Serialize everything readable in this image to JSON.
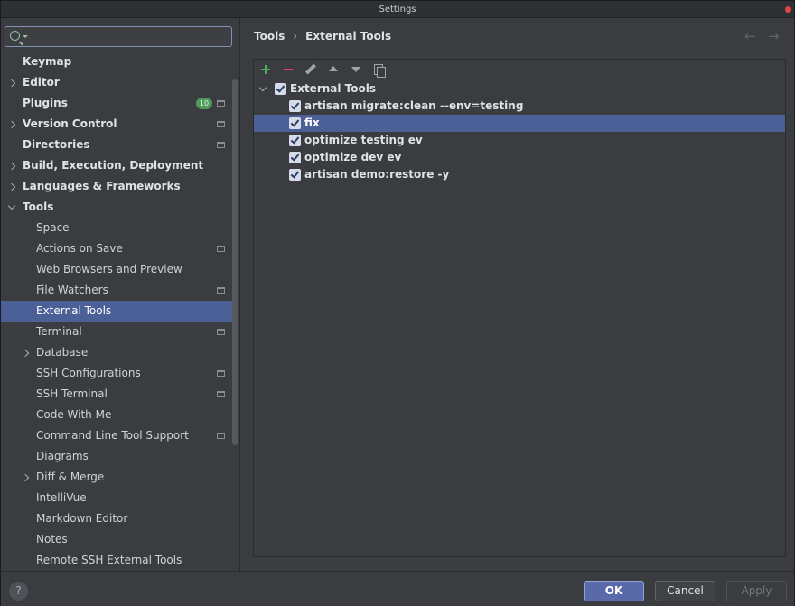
{
  "window": {
    "title": "Settings"
  },
  "search": {
    "placeholder": "",
    "value": ""
  },
  "sidebar": {
    "items": [
      {
        "label": "Keymap",
        "level": 0,
        "chevron": "none",
        "project_icon": false
      },
      {
        "label": "Editor",
        "level": 0,
        "chevron": "right",
        "project_icon": false
      },
      {
        "label": "Plugins",
        "level": 0,
        "chevron": "none",
        "badge": "10",
        "project_icon": true
      },
      {
        "label": "Version Control",
        "level": 0,
        "chevron": "right",
        "project_icon": true
      },
      {
        "label": "Directories",
        "level": 0,
        "chevron": "none",
        "project_icon": true
      },
      {
        "label": "Build, Execution, Deployment",
        "level": 0,
        "chevron": "right",
        "project_icon": false
      },
      {
        "label": "Languages & Frameworks",
        "level": 0,
        "chevron": "right",
        "project_icon": false
      },
      {
        "label": "Tools",
        "level": 0,
        "chevron": "down",
        "project_icon": false
      },
      {
        "label": "Space",
        "level": 1,
        "chevron": "none",
        "project_icon": false
      },
      {
        "label": "Actions on Save",
        "level": 1,
        "chevron": "none",
        "project_icon": true
      },
      {
        "label": "Web Browsers and Preview",
        "level": 1,
        "chevron": "none",
        "project_icon": false
      },
      {
        "label": "File Watchers",
        "level": 1,
        "chevron": "none",
        "project_icon": true
      },
      {
        "label": "External Tools",
        "level": 1,
        "chevron": "none",
        "project_icon": false,
        "selected": true
      },
      {
        "label": "Terminal",
        "level": 1,
        "chevron": "none",
        "project_icon": true
      },
      {
        "label": "Database",
        "level": 1,
        "chevron": "right",
        "project_icon": false
      },
      {
        "label": "SSH Configurations",
        "level": 1,
        "chevron": "none",
        "project_icon": true
      },
      {
        "label": "SSH Terminal",
        "level": 1,
        "chevron": "none",
        "project_icon": true
      },
      {
        "label": "Code With Me",
        "level": 1,
        "chevron": "none",
        "project_icon": false
      },
      {
        "label": "Command Line Tool Support",
        "level": 1,
        "chevron": "none",
        "project_icon": true
      },
      {
        "label": "Diagrams",
        "level": 1,
        "chevron": "none",
        "project_icon": false
      },
      {
        "label": "Diff & Merge",
        "level": 1,
        "chevron": "right",
        "project_icon": false
      },
      {
        "label": "IntelliVue",
        "level": 1,
        "chevron": "none",
        "project_icon": false
      },
      {
        "label": "Markdown Editor",
        "level": 1,
        "chevron": "none",
        "project_icon": false
      },
      {
        "label": "Notes",
        "level": 1,
        "chevron": "none",
        "project_icon": false
      },
      {
        "label": "Remote SSH External Tools",
        "level": 1,
        "chevron": "none",
        "project_icon": false
      }
    ]
  },
  "breadcrumb": {
    "parent": "Tools",
    "separator": "›",
    "current": "External Tools"
  },
  "nav": {
    "back": "←",
    "forward": "→"
  },
  "toolbar": {
    "buttons": [
      "add-icon",
      "remove-icon",
      "edit-icon",
      "move-up-icon",
      "move-down-icon",
      "copy-icon"
    ]
  },
  "external_tools": {
    "group": {
      "label": "External Tools",
      "checked": true
    },
    "tools": [
      {
        "label": "artisan migrate:clean --env=testing",
        "checked": true
      },
      {
        "label": "fix",
        "checked": true,
        "selected": true
      },
      {
        "label": "optimize testing ev",
        "checked": true
      },
      {
        "label": "optimize dev ev",
        "checked": true
      },
      {
        "label": "artisan demo:restore -y",
        "checked": true
      }
    ]
  },
  "footer": {
    "help": "?",
    "ok": "OK",
    "cancel": "Cancel",
    "apply": "Apply"
  },
  "colors": {
    "selection": "#4b6096",
    "accent_ok": "#5a6aa8",
    "badge": "#4e9a5a",
    "add": "#49b35b",
    "remove": "#d9485a"
  }
}
